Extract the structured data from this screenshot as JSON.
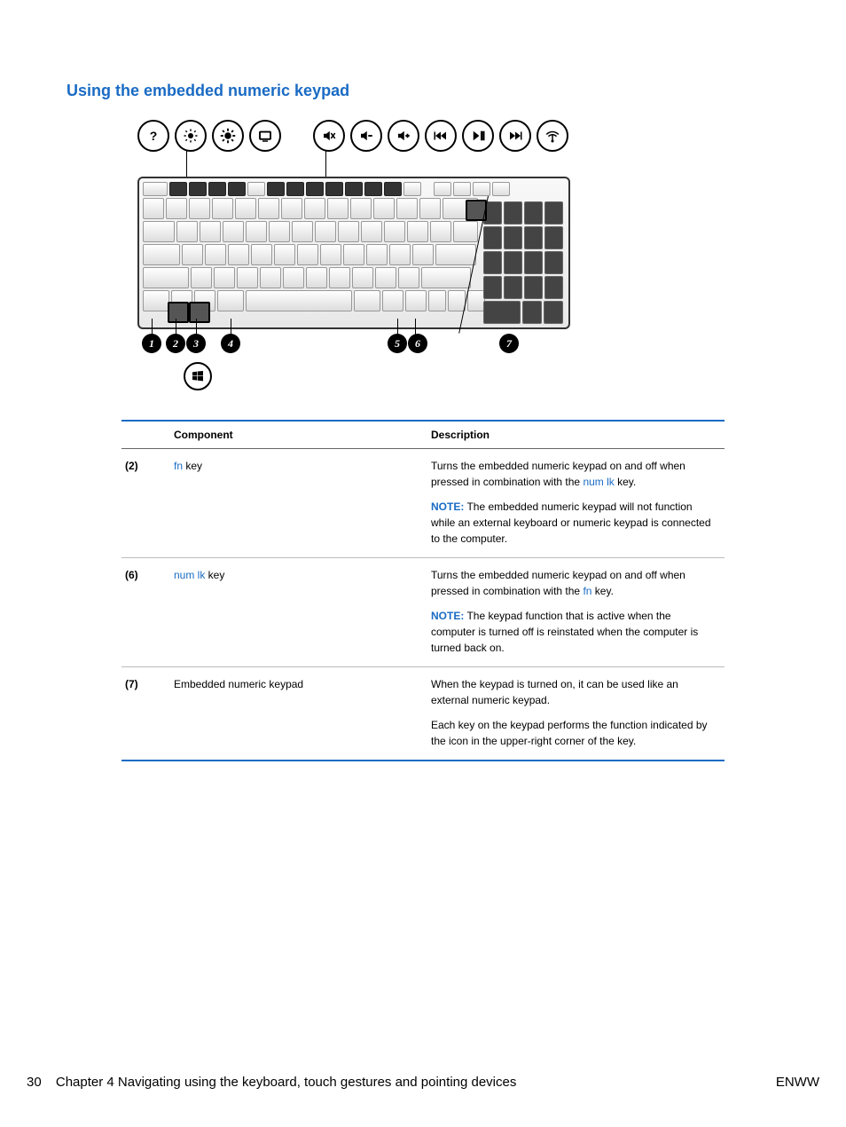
{
  "heading": "Using the embedded numeric keypad",
  "callout_numbers": [
    "1",
    "2",
    "3",
    "4",
    "5",
    "6",
    "7"
  ],
  "table": {
    "headers": {
      "component": "Component",
      "description": "Description"
    },
    "rows": [
      {
        "num": "(2)",
        "component_link": "fn",
        "component_rest": " key",
        "desc": [
          {
            "text_before": "Turns the embedded numeric keypad on and off when pressed in combination with the ",
            "link": "num lk",
            "text_after": " key."
          },
          {
            "note": "NOTE:",
            "text": "   The embedded numeric keypad will not function while an external keyboard or numeric keypad is connected to the computer."
          }
        ]
      },
      {
        "num": "(6)",
        "component_link": "num lk",
        "component_rest": " key",
        "desc": [
          {
            "text_before": "Turns the embedded numeric keypad on and off when pressed in combination with the ",
            "link": "fn",
            "text_after": " key."
          },
          {
            "note": "NOTE:",
            "text": "   The keypad function that is active when the computer is turned off is reinstated when the computer is turned back on."
          }
        ]
      },
      {
        "num": "(7)",
        "component_plain": "Embedded numeric keypad",
        "desc": [
          {
            "plain": "When the keypad is turned on, it can be used like an external numeric keypad."
          },
          {
            "plain": "Each key on the keypad performs the function indicated by the icon in the upper-right corner of the key."
          }
        ]
      }
    ]
  },
  "footer": {
    "page": "30",
    "chapter": "Chapter 4   Navigating using the keyboard, touch gestures and pointing devices",
    "right": "ENWW"
  }
}
